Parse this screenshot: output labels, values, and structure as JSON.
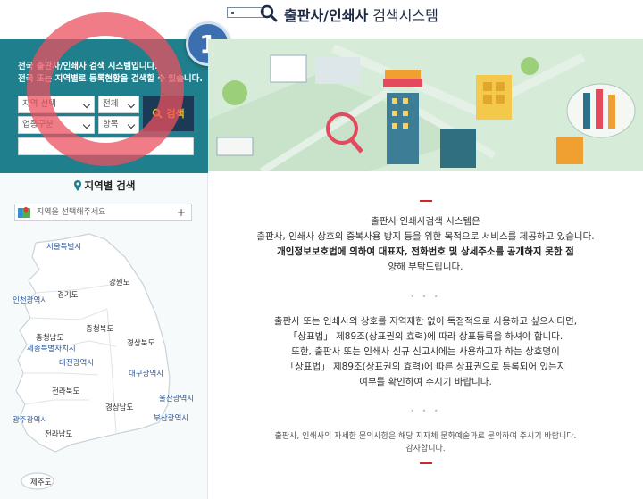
{
  "header": {
    "title_bold": "출판사/인쇄사",
    "title_rest": " 검색시스템",
    "search_icon": "search-icon"
  },
  "search_panel": {
    "intro_line1": "전국 출판사/인쇄사 검색 시스템입니다.",
    "intro_line2": "전국 또는 지역별로 등록현황을 검색할 수 있습니다.",
    "region_select": "지역 선택",
    "all_select": "전체",
    "type_select": "업종구분",
    "item_select": "항목",
    "search_button": "검색"
  },
  "badge": {
    "number": "1"
  },
  "region_search": {
    "title": "지역별 검색",
    "placeholder": "지역을 선택해주세요",
    "plus": "+"
  },
  "map_labels": {
    "seoul": "서울특별시",
    "incheon": "인천광역시",
    "gyeonggi": "경기도",
    "gangwon": "강원도",
    "chungbuk": "충청북도",
    "chungnam": "충청남도",
    "sejong": "세종특별자치시",
    "daejeon": "대전광역시",
    "gyeongbuk": "경상북도",
    "daegu": "대구광역시",
    "jeonbuk": "전라북도",
    "ulsan": "울산광역시",
    "gyeongnam": "경상남도",
    "busan": "부산광역시",
    "gwangju": "광주광역시",
    "jeonnam": "전라남도",
    "jeju": "제주도"
  },
  "content": {
    "p1_line1": "출판사 인쇄사검색 시스템은",
    "p1_line2": "출판사, 인쇄사 상호의 중복사용 방지 등을 위한 목적으로 서비스를 제공하고 있습니다.",
    "p1_line3": "개인정보보호법에 의하여 대표자, 전화번호 및 상세주소를 공개하지 못한 점",
    "p1_line4": "양해 부탁드립니다.",
    "dots": "• • •",
    "p2_line1": "출판사 또는 인쇄사의 상호를 지역제한 없이 독점적으로 사용하고 싶으시다면,",
    "p2_line2": "「상표법」 제89조(상표권의 효력)에 따라 상표등록을 하셔야 합니다.",
    "p2_line3": "또한, 출판사 또는 인쇄사 신규 신고시에는 사용하고자 하는 상호명이",
    "p2_line4": "「상표법」 제89조(상표권의 효력)에 따른 상표권으로 등록되어 있는지",
    "p2_line5": "여부를 확인하여 주시기 바랍니다.",
    "p3_line1": "출판사, 인쇄사의 자세한 문의사항은 해당 지자체 문화예술과로 문의하여 주시기 바랍니다.",
    "p3_line2": "감사합니다."
  },
  "colors": {
    "panel": "#1f7f8c",
    "accent_red": "#c92a2a",
    "search_btn": "#1a3a55",
    "badge": "#3b6fb0"
  }
}
